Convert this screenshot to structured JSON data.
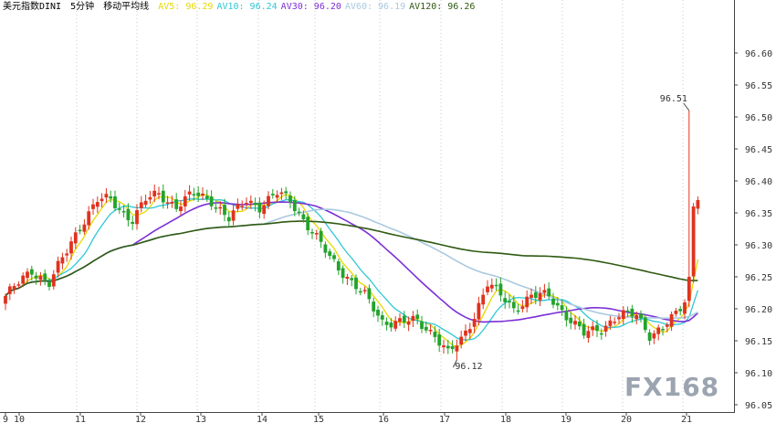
{
  "legend": {
    "symbol": "美元指数DINI",
    "period": "5分钟",
    "study": "移动平均线",
    "items": [
      {
        "label": "AV5:",
        "value": "96.29",
        "color": "#e6d800"
      },
      {
        "label": "AV10:",
        "value": "96.24",
        "color": "#2ec7d6"
      },
      {
        "label": "AV30:",
        "value": "96.20",
        "color": "#7b2fd6"
      },
      {
        "label": "AV60:",
        "value": "96.19",
        "color": "#a9c9e0"
      },
      {
        "label": "AV120:",
        "value": "96.26",
        "color": "#2f5a12"
      }
    ]
  },
  "logo_text": "FX168",
  "chart_data": {
    "type": "candlestick",
    "title": "",
    "ylim": [
      96.05,
      96.6
    ],
    "y_ticks": [
      "96.05",
      "96.10",
      "96.15",
      "96.20",
      "96.25",
      "96.30",
      "96.35",
      "96.40",
      "96.45",
      "96.50",
      "96.55",
      "96.60"
    ],
    "x_tick_labels": [
      "9",
      "10",
      "11",
      "12",
      "13",
      "14",
      "15",
      "16",
      "17",
      "18",
      "19",
      "20",
      "21"
    ],
    "grid": "dotted vertical day separators",
    "annotations": [
      {
        "text": "96.51",
        "role": "high"
      },
      {
        "text": "96.12",
        "role": "low"
      }
    ],
    "anchors": [
      {
        "t": 0,
        "p": 96.22
      },
      {
        "t": 6,
        "p": 96.26
      },
      {
        "t": 10,
        "p": 96.24
      },
      {
        "t": 14,
        "p": 96.29
      },
      {
        "t": 17,
        "p": 96.33
      },
      {
        "t": 21,
        "p": 96.37
      },
      {
        "t": 24,
        "p": 96.37
      },
      {
        "t": 27,
        "p": 96.35
      },
      {
        "t": 29,
        "p": 96.34
      },
      {
        "t": 32,
        "p": 96.37
      },
      {
        "t": 35,
        "p": 96.38
      },
      {
        "t": 39,
        "p": 96.36
      },
      {
        "t": 43,
        "p": 96.38
      },
      {
        "t": 47,
        "p": 96.37
      },
      {
        "t": 51,
        "p": 96.34
      },
      {
        "t": 55,
        "p": 96.37
      },
      {
        "t": 58,
        "p": 96.36
      },
      {
        "t": 62,
        "p": 96.38
      },
      {
        "t": 65,
        "p": 96.37
      },
      {
        "t": 68,
        "p": 96.34
      },
      {
        "t": 71,
        "p": 96.31
      },
      {
        "t": 74,
        "p": 96.28
      },
      {
        "t": 78,
        "p": 96.25
      },
      {
        "t": 82,
        "p": 96.22
      },
      {
        "t": 86,
        "p": 96.18
      },
      {
        "t": 90,
        "p": 96.18
      },
      {
        "t": 94,
        "p": 96.18
      },
      {
        "t": 98,
        "p": 96.16
      },
      {
        "t": 101,
        "p": 96.13
      },
      {
        "t": 104,
        "p": 96.15
      },
      {
        "t": 107,
        "p": 96.19
      },
      {
        "t": 110,
        "p": 96.24
      },
      {
        "t": 113,
        "p": 96.22
      },
      {
        "t": 116,
        "p": 96.2
      },
      {
        "t": 120,
        "p": 96.22
      },
      {
        "t": 124,
        "p": 96.22
      },
      {
        "t": 128,
        "p": 96.19
      },
      {
        "t": 132,
        "p": 96.16
      },
      {
        "t": 136,
        "p": 96.17
      },
      {
        "t": 140,
        "p": 96.19
      },
      {
        "t": 144,
        "p": 96.19
      },
      {
        "t": 147,
        "p": 96.16
      },
      {
        "t": 150,
        "p": 96.17
      },
      {
        "t": 153,
        "p": 96.19
      },
      {
        "t": 155,
        "p": 96.21
      },
      {
        "t": 156,
        "p": 96.25
      },
      {
        "t": 157,
        "p": 96.36
      },
      {
        "t": 158,
        "p": 96.37
      }
    ],
    "spikes": [
      {
        "t": 156,
        "high": 96.51
      },
      {
        "t": 103,
        "low": 96.12
      }
    ],
    "moving_averages": [
      {
        "name": "AV5",
        "color": "#e6d800",
        "period": 5
      },
      {
        "name": "AV10",
        "color": "#2ec7d6",
        "period": 10
      },
      {
        "name": "AV30",
        "color": "#7b2fd6",
        "period": 30
      },
      {
        "name": "AV60",
        "color": "#a9c9e0",
        "period": 60
      },
      {
        "name": "AV120",
        "color": "#2f5a12",
        "period": 120
      }
    ],
    "candle_colors": {
      "up": "#e0321e",
      "down": "#23a32b"
    }
  }
}
